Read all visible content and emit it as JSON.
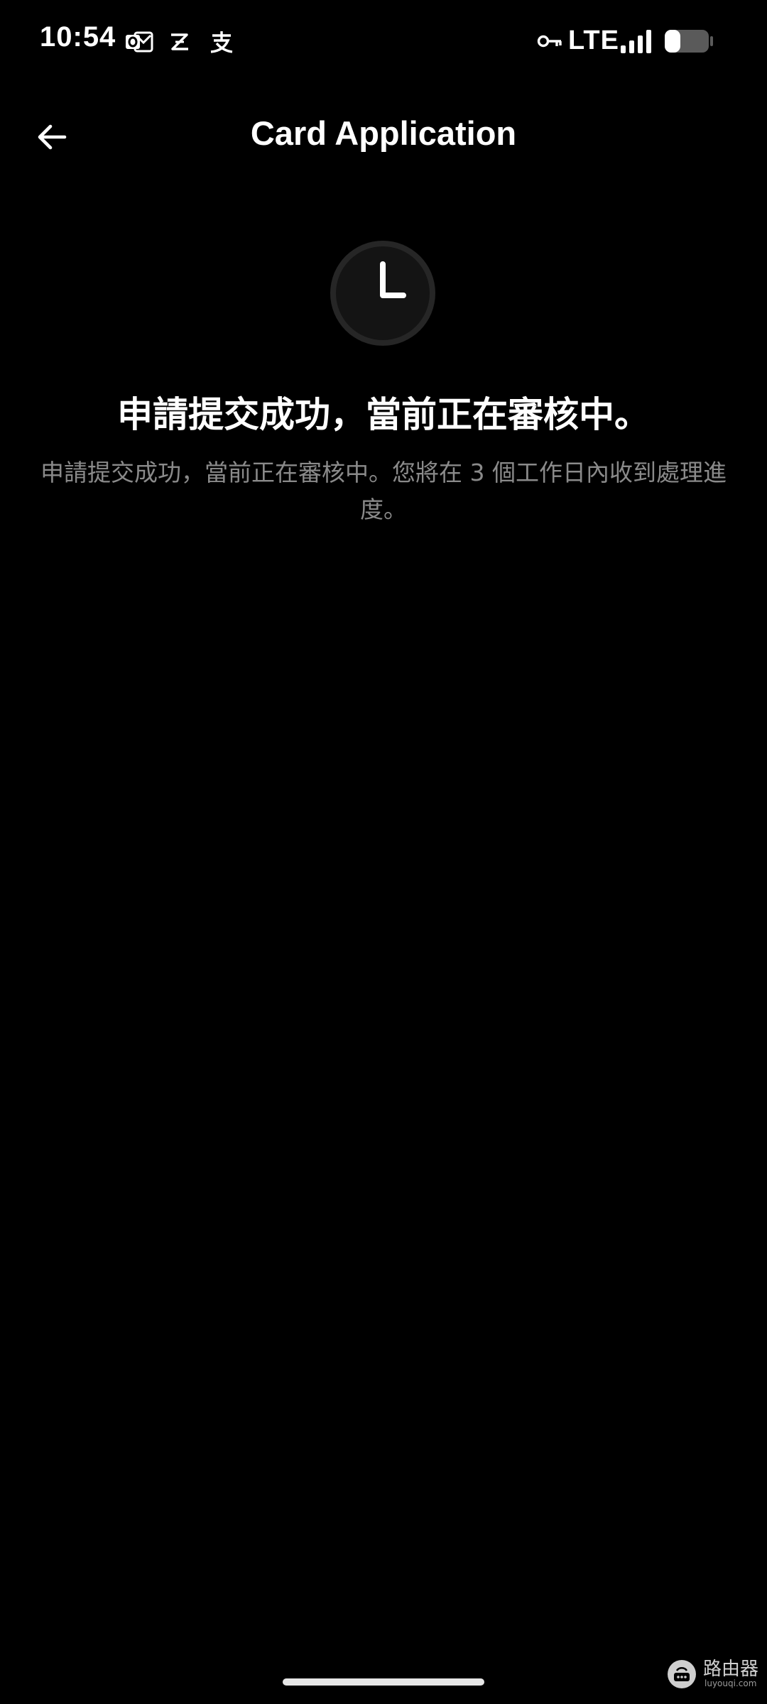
{
  "status_bar": {
    "time": "10:54",
    "notifications": [
      "outlook-icon",
      "zhihu-icon",
      "alipay-icon"
    ],
    "vpn_icon": "key-icon",
    "network": "LTE",
    "signal_icon": "signal-bars-icon",
    "battery_icon": "battery-icon",
    "battery_level": 0.35
  },
  "app_bar": {
    "back_icon": "arrow-left-icon",
    "title": "Card Application"
  },
  "result": {
    "status_icon": "clock-icon",
    "heading": "申請提交成功，當前正在審核中。",
    "description": "申請提交成功，當前正在審核中。您將在 3 個工作日內收到處理進度。"
  },
  "watermark": {
    "text": "路由器",
    "url": "luyouqi.com"
  },
  "colors": {
    "background": "#000000",
    "text_primary": "#ffffff",
    "text_secondary": "#8a8a8a",
    "clock_face": "#141414",
    "clock_ring": "#262626"
  }
}
